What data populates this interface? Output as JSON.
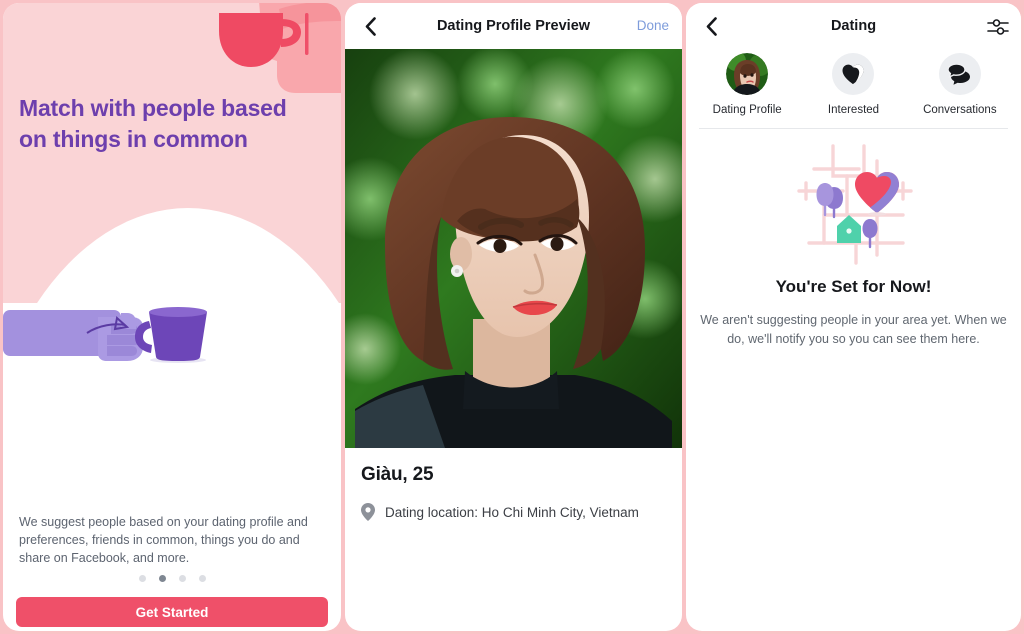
{
  "theme": {
    "page_background": "#f9c3c6",
    "onboarding_background": "#fad4d6",
    "heading_purple": "#6d3fad",
    "cta_red": "#ef5069",
    "link_blue": "#7e9cdb"
  },
  "onboarding": {
    "heading": "Match with people based on things in common",
    "description": "We suggest people based on your dating profile and preferences, friends in common, things you do and share on Facebook, and more.",
    "cta_label": "Get Started",
    "pager": {
      "total": 4,
      "active_index": 1
    },
    "illustrations": {
      "top_right": "hand-holding-red-cup-illustration",
      "mid_left": "hand-holding-purple-cup-illustration"
    }
  },
  "preview": {
    "nav": {
      "back_icon": "chevron-left-icon",
      "title": "Dating Profile Preview",
      "action_label": "Done"
    },
    "photo_alt": "profile-photo-woman-short-brown-hair-green-background",
    "name_age": "Giàu, 25",
    "location_icon": "location-pin-icon",
    "location": "Dating location: Ho Chi Minh City, Vietnam"
  },
  "dating": {
    "nav": {
      "back_icon": "chevron-left-icon",
      "title": "Dating",
      "settings_icon": "sliders-settings-icon"
    },
    "tabs": [
      {
        "label": "Dating Profile",
        "icon": "user-avatar-photo"
      },
      {
        "label": "Interested",
        "icon": "heart-icon"
      },
      {
        "label": "Conversations",
        "icon": "chat-bubbles-icon"
      }
    ],
    "empty_state": {
      "illustration": "neighborhood-map-heart-house-trees-illustration",
      "title": "You're Set for Now!",
      "body": "We aren't suggesting people in your area yet. When we do, we'll notify you so you can see them here."
    }
  }
}
